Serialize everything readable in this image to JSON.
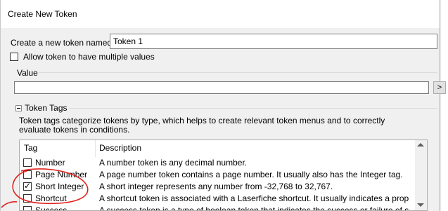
{
  "window": {
    "title": "Create New Token"
  },
  "token_name": {
    "label": "Create a new token named:",
    "value": "Token 1"
  },
  "multiple_values": {
    "label": "Allow token to have multiple values",
    "checked": false
  },
  "value_group": {
    "label": "Value",
    "input_value": "",
    "button_label": ">"
  },
  "tags_group": {
    "label": "Token Tags",
    "description": "Token tags categorize tokens by type, which helps to create relevant token menus and to correctly evaluate tokens in conditions."
  },
  "tag_list": {
    "columns": [
      "Tag",
      "Description"
    ],
    "rows": [
      {
        "tag": "Number",
        "description": "A number token is any decimal number.",
        "checked": false
      },
      {
        "tag": "Page Number",
        "description": "A page number token contains a page number. It usually also has the Integer tag.",
        "checked": false
      },
      {
        "tag": "Short Integer",
        "description": "A short integer represents any number from -32,768 to 32,767.",
        "checked": true
      },
      {
        "tag": "Shortcut",
        "description": "A shortcut token is associated with a Laserfiche shortcut. It usually indicates a property of the sh...",
        "checked": false
      },
      {
        "tag": "Success",
        "description": "A success token is a type of boolean token that indicates the success or failure of something.",
        "checked": false
      }
    ]
  },
  "colors": {
    "annotation": "#e0201c",
    "dialog_bg": "#f0f0f0"
  }
}
